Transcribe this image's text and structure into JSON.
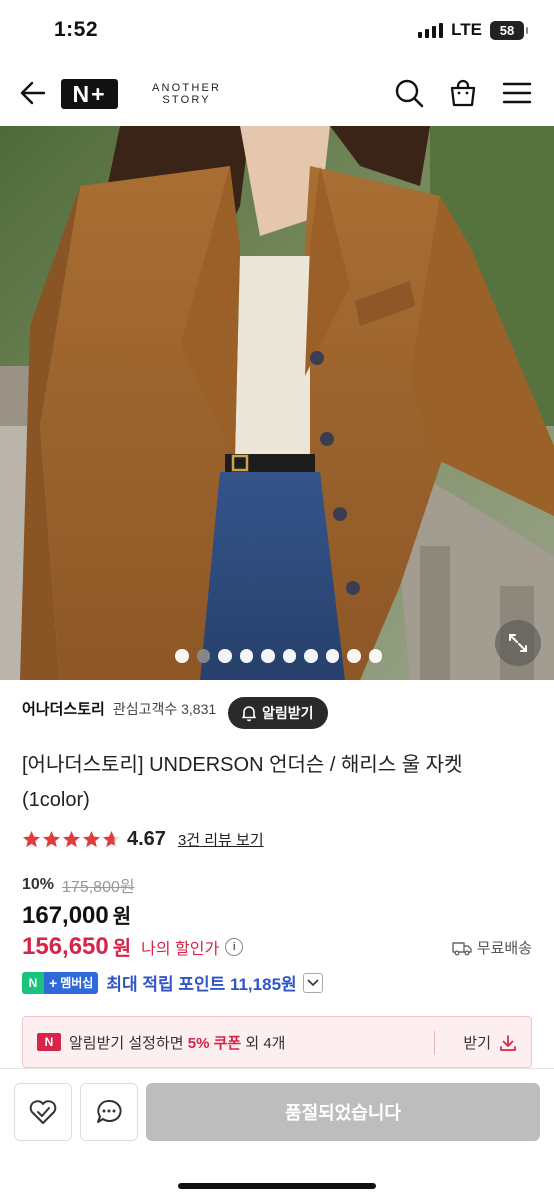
{
  "status_bar": {
    "time": "1:52",
    "network": "LTE",
    "battery": "58"
  },
  "header": {
    "logo": "N+",
    "brand_line1": "ANOTHER",
    "brand_line2": "STORY",
    "icons": [
      "back-arrow-icon",
      "search-icon",
      "shopping-bag-icon",
      "menu-icon"
    ]
  },
  "gallery": {
    "total_images": 10,
    "active_index": 1
  },
  "store": {
    "name": "어나더스토리",
    "followers_label": "관심고객수 3,831",
    "notify_label": "알림받기"
  },
  "product": {
    "title_line1": "[어나더스토리] UNDERSON 언더슨 / 해리스 울 자켓",
    "title_line2": "(1color)",
    "rating": "4.67",
    "review_link": "3건 리뷰 보기",
    "discount_pct": "10%",
    "original_price": "175,800원",
    "price": "167,000",
    "price_unit": "원",
    "my_price": "156,650",
    "my_price_unit": "원",
    "my_price_label": "나의 할인가",
    "shipping": "무료배송"
  },
  "membership": {
    "badge_n": "N",
    "badge_label": "멤버십",
    "points_text": "최대 적립 포인트 11,185원"
  },
  "coupon": {
    "logo": "N",
    "text_prefix": "알림받기 설정하면 ",
    "text_highlight": "5% 쿠폰",
    "text_suffix": " 외 4개",
    "action": "받기"
  },
  "bottom_bar": {
    "soldout_label": "품절되었습니다"
  },
  "colors": {
    "accent_red": "#d6244a",
    "point_blue": "#2f55c9",
    "member_green": "#19c37d"
  }
}
